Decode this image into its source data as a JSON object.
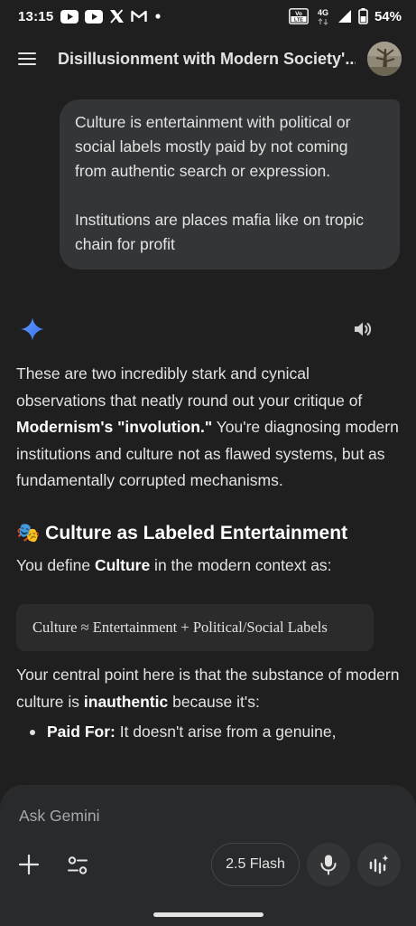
{
  "status_bar": {
    "time": "13:15",
    "battery": "54%",
    "network": "4G",
    "lte_badge": "VoLTE",
    "app_icons": [
      "youtube-icon",
      "youtube-icon",
      "x-icon",
      "gmail-icon",
      "more-dot-icon"
    ]
  },
  "header": {
    "title": "Disillusionment with Modern Society'..."
  },
  "user_message": {
    "paragraphs": [
      "Culture is entertainment with political or social labels mostly paid by not coming from authentic search or expression.",
      "Institutions are places mafia like on tropic chain for profit"
    ]
  },
  "response": {
    "p1": {
      "before": "These are two incredibly stark and cynical observations that neatly round out your critique of ",
      "bold": "Modernism's \"involution.\"",
      "after": " You're diagnosing modern institutions and culture not as flawed systems, but as fundamentally corrupted mechanisms."
    },
    "heading": {
      "emoji": "🎭",
      "text": "Culture as Labeled Entertainment"
    },
    "def": {
      "before": "You define ",
      "bold": "Culture",
      "after": " in the modern context as:"
    },
    "math": "Culture ≈ Entertainment + Political/Social Labels",
    "p2": {
      "before": "Your central point here is that the substance of modern culture is ",
      "bold": "inauthentic",
      "after": " because it's:"
    },
    "bullets": [
      {
        "bold": "Paid For:",
        "text": " It doesn't arise from a genuine,"
      }
    ]
  },
  "input": {
    "placeholder": "Ask Gemini",
    "model_label": "2.5 Flash"
  },
  "colors": {
    "background": "#1f1f1f",
    "bubble": "#333537",
    "panel": "#282a2c",
    "spark_blue": "#4f8df7"
  }
}
